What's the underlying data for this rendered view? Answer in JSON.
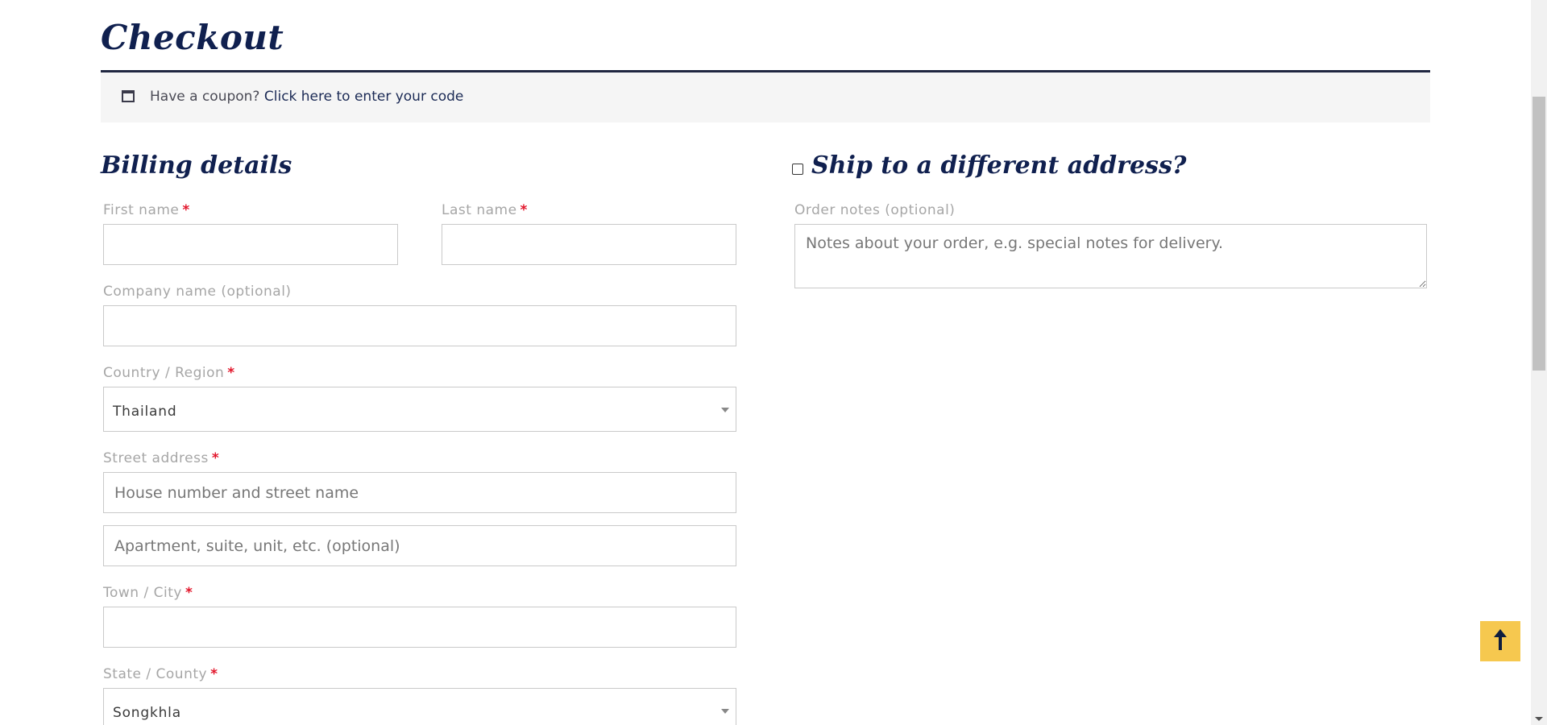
{
  "page": {
    "title": "Checkout"
  },
  "coupon": {
    "prefix": "Have a coupon?",
    "link_text": "Click here to enter your code",
    "icon": "coupon-icon"
  },
  "billing": {
    "title": "Billing details",
    "required_marker": "*",
    "first_name": {
      "label": "First name",
      "value": ""
    },
    "last_name": {
      "label": "Last name",
      "value": ""
    },
    "company": {
      "label": "Company name (optional)",
      "value": ""
    },
    "country": {
      "label": "Country / Region",
      "value": "Thailand"
    },
    "street": {
      "label": "Street address",
      "placeholder_1": "House number and street name",
      "placeholder_2": "Apartment, suite, unit, etc. (optional)"
    },
    "city": {
      "label": "Town / City",
      "value": ""
    },
    "state": {
      "label": "State / County",
      "value": "Songkhla"
    }
  },
  "shipping": {
    "title": "Ship to a different address?",
    "checked": false
  },
  "order_notes": {
    "label": "Order notes (optional)",
    "placeholder": "Notes about your order, e.g. special notes for delivery."
  },
  "colors": {
    "heading": "#10204f",
    "required": "#e2162b",
    "back_to_top": "#f6c84f"
  },
  "icons": {
    "back_to_top": "arrow-up-icon",
    "select_arrow": "caret-down-icon"
  }
}
